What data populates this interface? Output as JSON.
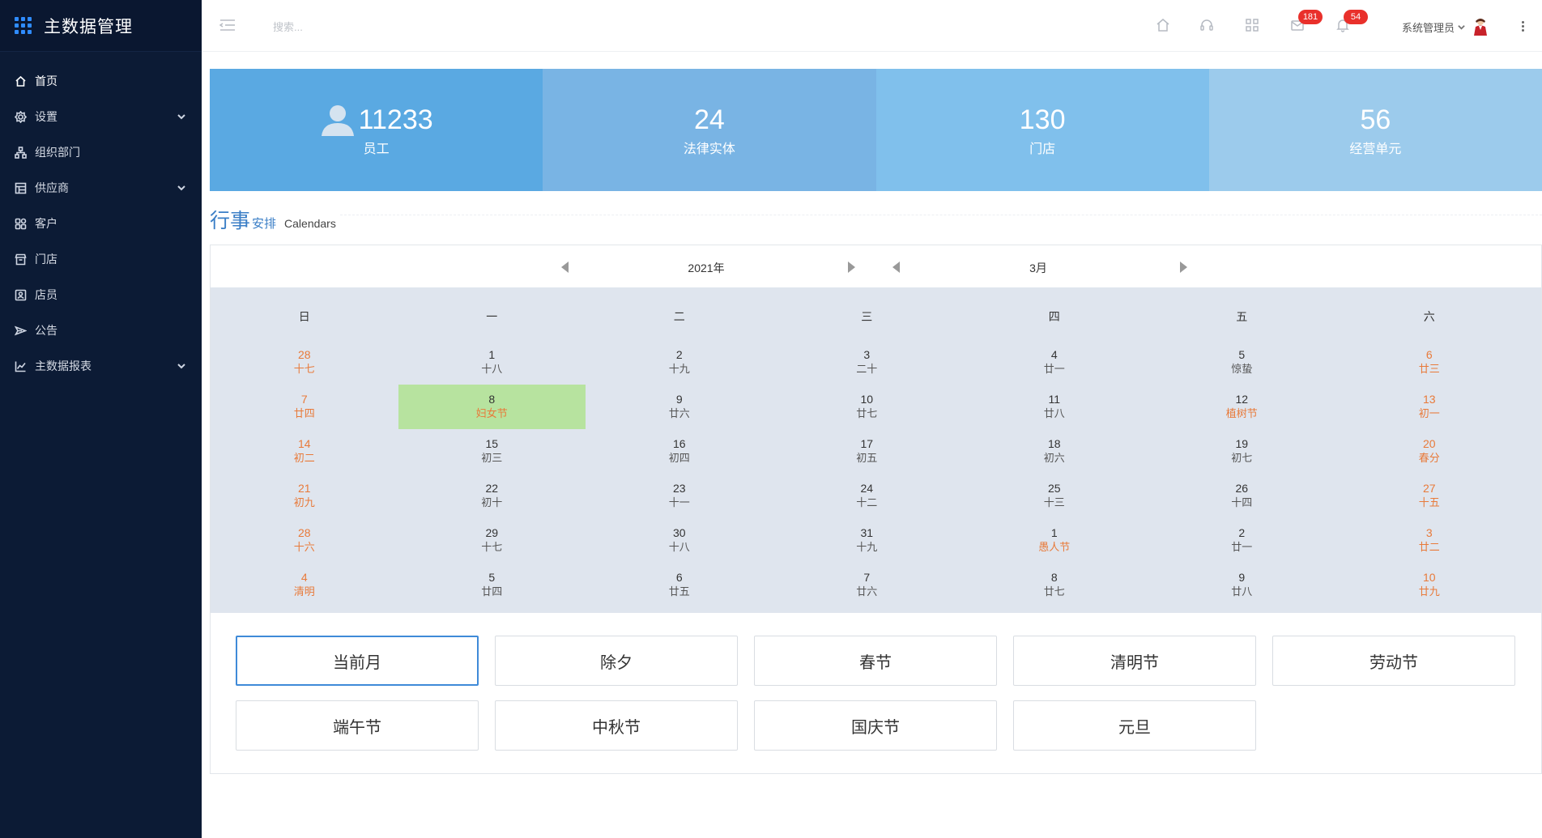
{
  "sidebar": {
    "title": "主数据管理",
    "items": [
      {
        "label": "首页",
        "icon": "home-icon",
        "has_children": false,
        "active": true
      },
      {
        "label": "设置",
        "icon": "gear-icon",
        "has_children": true,
        "active": false
      },
      {
        "label": "组织部门",
        "icon": "org-icon",
        "has_children": false,
        "active": false
      },
      {
        "label": "供应商",
        "icon": "supplier-icon",
        "has_children": true,
        "active": false
      },
      {
        "label": "客户",
        "icon": "customer-icon",
        "has_children": false,
        "active": false
      },
      {
        "label": "门店",
        "icon": "store-icon",
        "has_children": false,
        "active": false
      },
      {
        "label": "店员",
        "icon": "clerk-icon",
        "has_children": false,
        "active": false
      },
      {
        "label": "公告",
        "icon": "announcement-icon",
        "has_children": false,
        "active": false
      },
      {
        "label": "主数据报表",
        "icon": "chart-icon",
        "has_children": true,
        "active": false
      }
    ]
  },
  "header": {
    "search_placeholder": "搜索...",
    "messages_badge": "181",
    "notifications_badge": "54",
    "user_name": "系统管理员"
  },
  "stats": [
    {
      "number": "11233",
      "label": "员工",
      "color": "#5aa9e2"
    },
    {
      "number": "24",
      "label": "法律实体",
      "color": "#79b4e4"
    },
    {
      "number": "130",
      "label": "门店",
      "color": "#80c0ec"
    },
    {
      "number": "56",
      "label": "经营单元",
      "color": "#9ccbec"
    }
  ],
  "section": {
    "title_main": "行事",
    "title_sub": "安排",
    "title_en": "Calendars"
  },
  "calendar": {
    "year": "2021年",
    "month": "3月",
    "weekdays": [
      "日",
      "一",
      "二",
      "三",
      "四",
      "五",
      "六"
    ],
    "weeks": [
      [
        {
          "num": "28",
          "lunar": "十七",
          "red": true
        },
        {
          "num": "1",
          "lunar": "十八"
        },
        {
          "num": "2",
          "lunar": "十九"
        },
        {
          "num": "3",
          "lunar": "二十"
        },
        {
          "num": "4",
          "lunar": "廿一"
        },
        {
          "num": "5",
          "lunar": "惊蛰"
        },
        {
          "num": "6",
          "lunar": "廿三",
          "red": true
        }
      ],
      [
        {
          "num": "7",
          "lunar": "廿四",
          "red": true
        },
        {
          "num": "8",
          "lunar": "妇女节",
          "lunar_red": true,
          "selected": true
        },
        {
          "num": "9",
          "lunar": "廿六"
        },
        {
          "num": "10",
          "lunar": "廿七"
        },
        {
          "num": "11",
          "lunar": "廿八"
        },
        {
          "num": "12",
          "lunar": "植树节",
          "lunar_red": true
        },
        {
          "num": "13",
          "lunar": "初一",
          "red": true
        }
      ],
      [
        {
          "num": "14",
          "lunar": "初二",
          "red": true
        },
        {
          "num": "15",
          "lunar": "初三"
        },
        {
          "num": "16",
          "lunar": "初四"
        },
        {
          "num": "17",
          "lunar": "初五"
        },
        {
          "num": "18",
          "lunar": "初六"
        },
        {
          "num": "19",
          "lunar": "初七"
        },
        {
          "num": "20",
          "lunar": "春分",
          "red": true
        }
      ],
      [
        {
          "num": "21",
          "lunar": "初九",
          "red": true
        },
        {
          "num": "22",
          "lunar": "初十"
        },
        {
          "num": "23",
          "lunar": "十一"
        },
        {
          "num": "24",
          "lunar": "十二"
        },
        {
          "num": "25",
          "lunar": "十三"
        },
        {
          "num": "26",
          "lunar": "十四"
        },
        {
          "num": "27",
          "lunar": "十五",
          "red": true
        }
      ],
      [
        {
          "num": "28",
          "lunar": "十六",
          "red": true
        },
        {
          "num": "29",
          "lunar": "十七"
        },
        {
          "num": "30",
          "lunar": "十八"
        },
        {
          "num": "31",
          "lunar": "十九"
        },
        {
          "num": "1",
          "lunar": "愚人节",
          "lunar_red": true
        },
        {
          "num": "2",
          "lunar": "廿一"
        },
        {
          "num": "3",
          "lunar": "廿二",
          "red": true
        }
      ],
      [
        {
          "num": "4",
          "lunar": "清明",
          "red": true
        },
        {
          "num": "5",
          "lunar": "廿四"
        },
        {
          "num": "6",
          "lunar": "廿五"
        },
        {
          "num": "7",
          "lunar": "廿六"
        },
        {
          "num": "8",
          "lunar": "廿七"
        },
        {
          "num": "9",
          "lunar": "廿八"
        },
        {
          "num": "10",
          "lunar": "廿九",
          "red": true
        }
      ]
    ],
    "holiday_buttons": [
      {
        "label": "当前月",
        "active": true
      },
      {
        "label": "除夕"
      },
      {
        "label": "春节"
      },
      {
        "label": "清明节"
      },
      {
        "label": "劳动节"
      },
      {
        "label": "端午节"
      },
      {
        "label": "中秋节"
      },
      {
        "label": "国庆节"
      },
      {
        "label": "元旦"
      }
    ]
  },
  "colors": {
    "sidebar_bg": "#0c1b35",
    "accent": "#3a7ec6",
    "holiday_red": "#e87a3a",
    "selected_day": "#b7e39f",
    "badge": "#e9302b"
  }
}
